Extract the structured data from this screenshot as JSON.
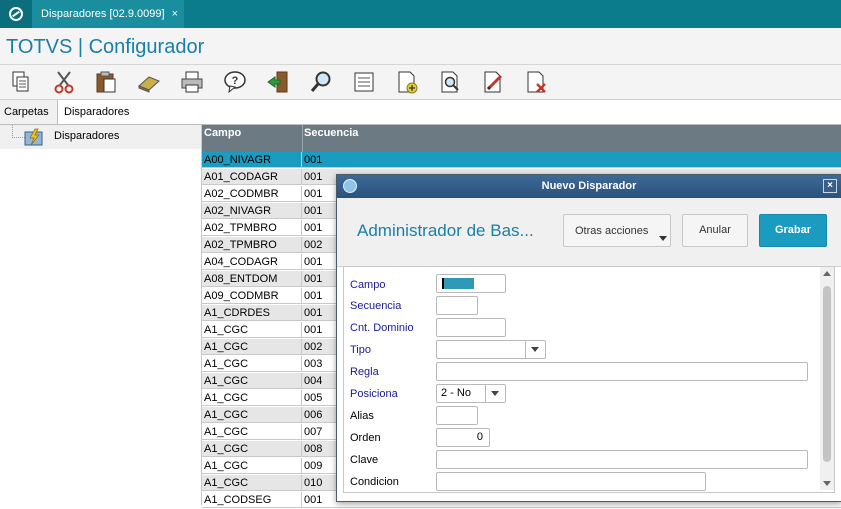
{
  "window": {
    "tab_title": "Disparadores [02.9.0099]",
    "tab_close": "×"
  },
  "app": {
    "title": "TOTVS | Configurador"
  },
  "toolbar": [
    "copy-icon",
    "cut-icon",
    "paste-icon",
    "eraser-icon",
    "print-icon",
    "help-icon",
    "exit-icon",
    "search-icon",
    "list-icon",
    "new-document-icon",
    "preview-icon",
    "edit-icon",
    "delete-document-icon"
  ],
  "panel_tabs": {
    "carpetas": "Carpetas",
    "disparadores": "Disparadores"
  },
  "tree": {
    "item": "Disparadores"
  },
  "grid": {
    "columns": [
      "Campo",
      "Secuencia"
    ],
    "rows": [
      [
        "A00_NIVAGR",
        "001"
      ],
      [
        "A01_CODAGR",
        "001"
      ],
      [
        "A02_CODMBR",
        "001"
      ],
      [
        "A02_NIVAGR",
        "001"
      ],
      [
        "A02_TPMBRO",
        "001"
      ],
      [
        "A02_TPMBRO",
        "002"
      ],
      [
        "A04_CODAGR",
        "001"
      ],
      [
        "A08_ENTDOM",
        "001"
      ],
      [
        "A09_CODMBR",
        "001"
      ],
      [
        "A1_CDRDES",
        "001"
      ],
      [
        "A1_CGC",
        "001"
      ],
      [
        "A1_CGC",
        "002"
      ],
      [
        "A1_CGC",
        "003"
      ],
      [
        "A1_CGC",
        "004"
      ],
      [
        "A1_CGC",
        "005"
      ],
      [
        "A1_CGC",
        "006"
      ],
      [
        "A1_CGC",
        "007"
      ],
      [
        "A1_CGC",
        "008"
      ],
      [
        "A1_CGC",
        "009"
      ],
      [
        "A1_CGC",
        "010"
      ],
      [
        "A1_CODSEG",
        "001"
      ]
    ]
  },
  "dialog": {
    "title": "Nuevo Disparador",
    "close": "×",
    "heading": "Administrador de Bas...",
    "btn_otras": "Otras acciones",
    "btn_anular": "Anular",
    "btn_grabar": "Grabar",
    "fields": {
      "campo": "Campo",
      "secuencia": "Secuencia",
      "cnt_dominio": "Cnt. Dominio",
      "tipo": "Tipo",
      "regla": "Regla",
      "posiciona": "Posiciona",
      "posiciona_value": "2 - No",
      "alias": "Alias",
      "orden": "Orden",
      "orden_value": "0",
      "clave": "Clave",
      "condicion": "Condicion"
    }
  },
  "colors": {
    "brand": "#0a7c8c",
    "accent": "#1a9bc0",
    "title": "#1a7fa8"
  }
}
